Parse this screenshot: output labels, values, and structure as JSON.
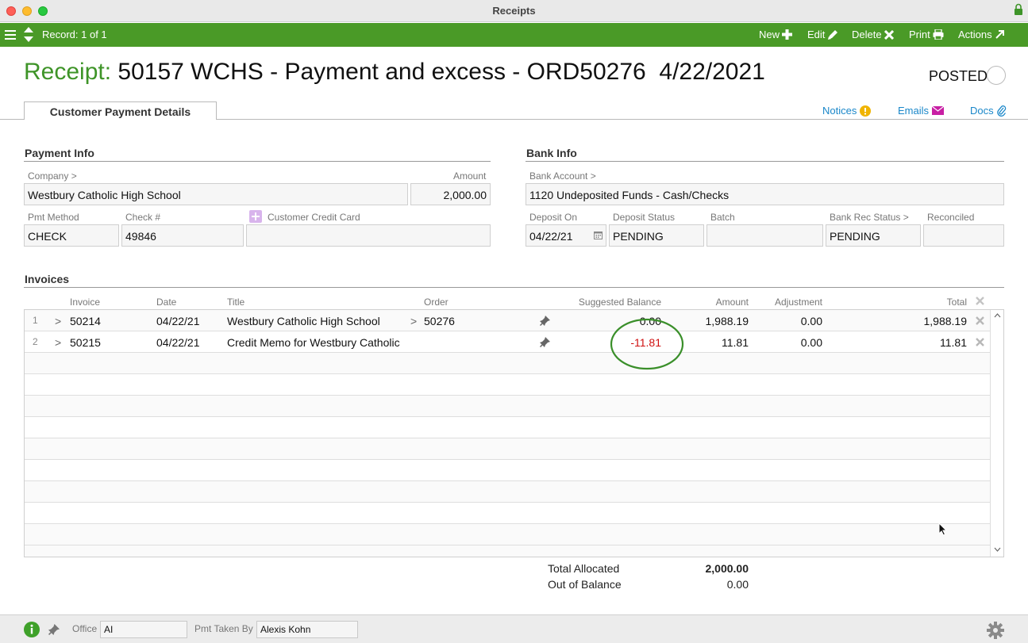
{
  "window": {
    "title": "Receipts"
  },
  "toolbar": {
    "record_label": "Record: 1 of 1",
    "new_label": "New",
    "edit_label": "Edit",
    "delete_label": "Delete",
    "print_label": "Print",
    "actions_label": "Actions"
  },
  "header": {
    "label": "Receipt:",
    "title": "50157 WCHS - Payment and excess - ORD50276  4/22/2021",
    "status": "POSTED"
  },
  "tabs": {
    "active": "Customer Payment Details",
    "notices_label": "Notices",
    "emails_label": "Emails",
    "docs_label": "Docs"
  },
  "payment_info": {
    "title": "Payment Info",
    "company_label": "Company >",
    "company": "Westbury Catholic High School",
    "amount_label": "Amount",
    "amount": "2,000.00",
    "pmt_method_label": "Pmt Method",
    "pmt_method": "CHECK",
    "check_label": "Check #",
    "check": "49846",
    "credit_card_label": "Customer Credit Card",
    "credit_card": ""
  },
  "bank_info": {
    "title": "Bank Info",
    "bank_account_label": "Bank Account >",
    "bank_account": "1120 Undeposited Funds - Cash/Checks",
    "deposit_on_label": "Deposit On",
    "deposit_on": "04/22/21",
    "deposit_status_label": "Deposit Status",
    "deposit_status": "PENDING",
    "batch_label": "Batch",
    "batch": "",
    "bank_rec_label": "Bank Rec Status >",
    "bank_rec": "PENDING",
    "reconciled_label": "Reconciled",
    "reconciled": ""
  },
  "invoices": {
    "title": "Invoices",
    "columns": {
      "invoice": "Invoice",
      "date": "Date",
      "title": "Title",
      "order": "Order",
      "suggested_balance": "Suggested Balance",
      "amount": "Amount",
      "adjustment": "Adjustment",
      "total": "Total"
    },
    "rows": [
      {
        "num": "1",
        "invoice": "50214",
        "date": "04/22/21",
        "title": "Westbury Catholic High School",
        "order": "50276",
        "suggested_balance": "0.00",
        "amount": "1,988.19",
        "adjustment": "0.00",
        "total": "1,988.19"
      },
      {
        "num": "2",
        "invoice": "50215",
        "date": "04/22/21",
        "title": "Credit Memo for Westbury Catholic",
        "order": "",
        "suggested_balance": "-11.81",
        "amount": "11.81",
        "adjustment": "0.00",
        "total": "11.81"
      }
    ]
  },
  "summary": {
    "total_allocated_label": "Total Allocated",
    "total_allocated": "2,000.00",
    "out_of_balance_label": "Out of Balance",
    "out_of_balance": "0.00"
  },
  "statusbar": {
    "office_label": "Office",
    "office": "AI",
    "pmt_taken_by_label": "Pmt Taken By",
    "pmt_taken_by": "Alexis Kohn"
  },
  "colors": {
    "toolbar_green": "#4a9a27",
    "title_green": "#3e9428",
    "link_blue": "#1a87c9",
    "negative_red": "#d01010",
    "annotation_circle": "#3a8f2a"
  }
}
